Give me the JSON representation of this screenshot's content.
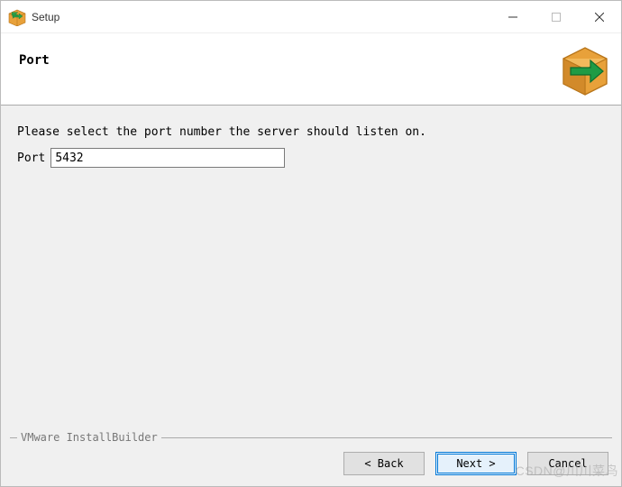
{
  "window": {
    "title": "Setup"
  },
  "header": {
    "title": "Port"
  },
  "content": {
    "prompt": "Please select the port number the server should listen on.",
    "port_label": "Port",
    "port_value": "5432"
  },
  "footer": {
    "brand": "VMware InstallBuilder",
    "buttons": {
      "back": "< Back",
      "next": "Next >",
      "cancel": "Cancel"
    }
  },
  "watermark": "CSDN@川川菜鸟"
}
